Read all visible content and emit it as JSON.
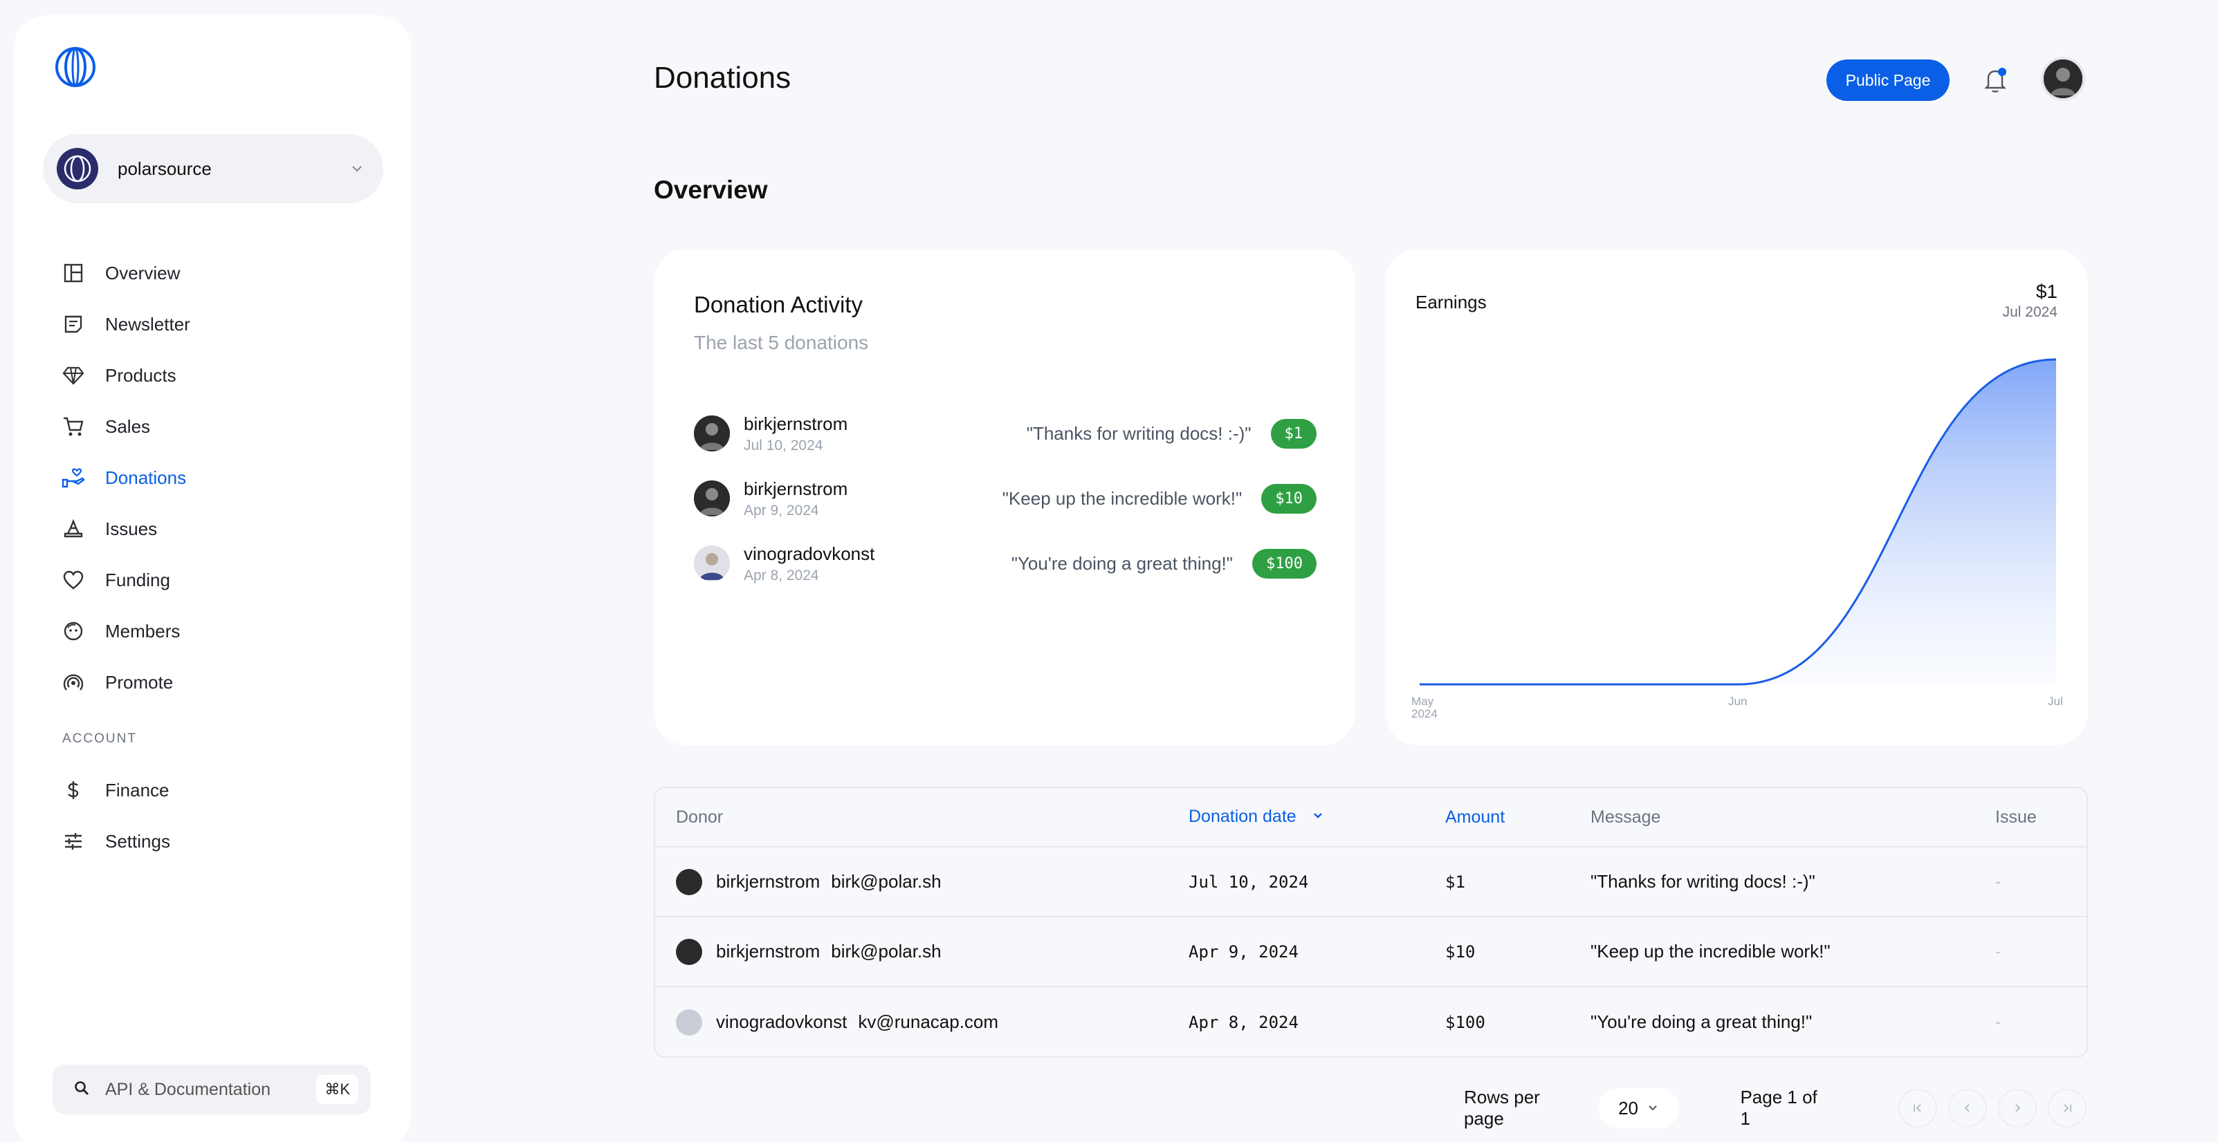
{
  "sidebar": {
    "org_name": "polarsource",
    "items": [
      {
        "label": "Overview",
        "icon": "layout-icon"
      },
      {
        "label": "Newsletter",
        "icon": "newsletter-icon"
      },
      {
        "label": "Products",
        "icon": "diamond-icon"
      },
      {
        "label": "Sales",
        "icon": "cart-icon"
      },
      {
        "label": "Donations",
        "icon": "donation-hand-icon",
        "active": true
      },
      {
        "label": "Issues",
        "icon": "issues-icon"
      },
      {
        "label": "Funding",
        "icon": "heart-icon"
      },
      {
        "label": "Members",
        "icon": "face-icon"
      },
      {
        "label": "Promote",
        "icon": "broadcast-icon"
      }
    ],
    "account_section": "ACCOUNT",
    "account_items": [
      {
        "label": "Finance",
        "icon": "dollar-icon"
      },
      {
        "label": "Settings",
        "icon": "sliders-icon"
      }
    ],
    "api_doc_label": "API & Documentation",
    "api_doc_shortcut": "⌘K"
  },
  "header": {
    "title": "Donations",
    "public_page_label": "Public Page"
  },
  "overview": {
    "title": "Overview",
    "activity": {
      "title": "Donation Activity",
      "subtitle": "The last 5 donations",
      "items": [
        {
          "name": "birkjernstrom",
          "date": "Jul 10, 2024",
          "message": "\"Thanks for writing docs! :-)\"",
          "amount": "$1"
        },
        {
          "name": "birkjernstrom",
          "date": "Apr 9, 2024",
          "message": "\"Keep up the incredible work!\"",
          "amount": "$10"
        },
        {
          "name": "vinogradovkonst",
          "date": "Apr 8, 2024",
          "message": "\"You're doing a great thing!\"",
          "amount": "$100"
        }
      ]
    },
    "earnings": {
      "title": "Earnings",
      "value": "$1",
      "date": "Jul 2024"
    }
  },
  "chart_data": {
    "type": "area",
    "title": "Earnings",
    "x": [
      "May 2024",
      "Jun",
      "Jul"
    ],
    "x_tick_labels": [
      "May",
      "2024",
      "Jun",
      "Jul"
    ],
    "values": [
      0,
      0,
      1
    ],
    "color": "#1a5ee6",
    "grid": false
  },
  "table": {
    "headers": {
      "donor": "Donor",
      "date": "Donation date",
      "amount": "Amount",
      "message": "Message",
      "issue": "Issue"
    },
    "rows": [
      {
        "name": "birkjernstrom",
        "email": "birk@polar.sh",
        "date": "Jul 10, 2024",
        "amount": "$1",
        "message": "\"Thanks for writing docs! :-)\"",
        "issue": "-"
      },
      {
        "name": "birkjernstrom",
        "email": "birk@polar.sh",
        "date": "Apr 9, 2024",
        "amount": "$10",
        "message": "\"Keep up the incredible work!\"",
        "issue": "-"
      },
      {
        "name": "vinogradovkonst",
        "email": "kv@runacap.com",
        "date": "Apr 8, 2024",
        "amount": "$100",
        "message": "\"You're doing a great thing!\"",
        "issue": "-"
      }
    ]
  },
  "pagination": {
    "rows_label": "Rows per page",
    "rows_value": "20",
    "page_info": "Page 1 of 1"
  },
  "colors": {
    "accent": "#0a5fe6",
    "success": "#2ea043"
  }
}
